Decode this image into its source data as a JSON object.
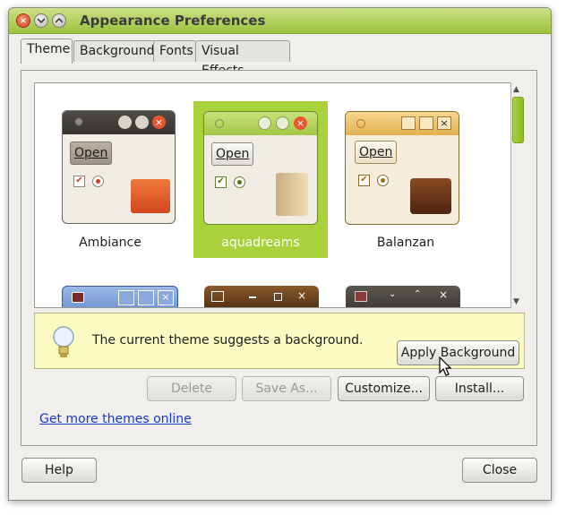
{
  "window": {
    "title": "Appearance Preferences"
  },
  "tabs": [
    {
      "label": "Theme",
      "active": true
    },
    {
      "label": "Background"
    },
    {
      "label": "Fonts"
    },
    {
      "label": "Visual Effects"
    }
  ],
  "themes": [
    {
      "name": "Ambiance",
      "open_label": "Open",
      "selected": false
    },
    {
      "name": "aquadreams",
      "open_label": "Open",
      "selected": true
    },
    {
      "name": "Balanzan",
      "open_label": "Open",
      "selected": false
    }
  ],
  "infobar": {
    "message": "The current theme suggests a background.",
    "apply_label": "Apply Background"
  },
  "actions": {
    "delete": "Delete",
    "save_as": "Save As...",
    "customize": "Customize...",
    "install": "Install..."
  },
  "link": "Get more themes online",
  "footer": {
    "help": "Help",
    "close": "Close"
  },
  "colors": {
    "accent": "#a8d13c",
    "titlebar": "#9cc23e",
    "link": "#1b37c7"
  }
}
